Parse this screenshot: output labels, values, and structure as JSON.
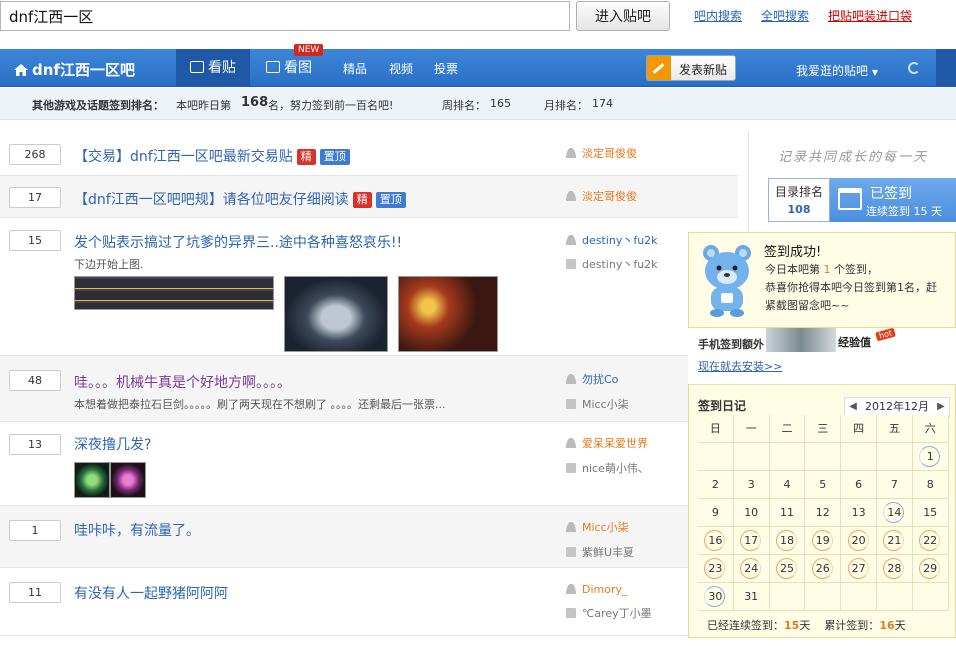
{
  "topbar": {
    "search_value": "dnf江西一区",
    "enter_label": "进入贴吧",
    "links": [
      "吧内搜索",
      "全吧搜索",
      "把贴吧装进口袋"
    ]
  },
  "nav": {
    "forum_title": "dnf江西一区吧",
    "tabs": [
      "看贴",
      "看图"
    ],
    "new_badge": "NEW",
    "links": [
      "精品",
      "视频",
      "投票"
    ],
    "post_button": "发表新贴",
    "fav_bars": "我爱逛的贴吧",
    "accent": "#2a6fc7"
  },
  "rank": {
    "label": "其他游戏及话题签到排名：",
    "yesterday_prefix": "本吧昨日第",
    "yesterday_rank": "168",
    "yesterday_suffix": "名，努力签到前一百名吧!",
    "week_label": "周排名：",
    "week_rank": "165",
    "month_label": "月排名：",
    "month_rank": "174"
  },
  "threads": [
    {
      "count": "268",
      "title": "【交易】dnf江西一区吧最新交易贴",
      "tags": [
        "精",
        "置顶"
      ],
      "author": "淡定哥俊俊"
    },
    {
      "count": "17",
      "title": "【dnf江西一区吧吧规】请各位吧友仔细阅读",
      "tags": [
        "精",
        "置顶"
      ],
      "author": "淡定哥俊俊"
    },
    {
      "count": "15",
      "title": "发个贴表示搞过了坑爹的异界三..途中各种喜怒哀乐!!",
      "excerpt": "下边开始上图.",
      "author": "destiny丶fu2k",
      "last_reply": "destiny丶fu2k"
    },
    {
      "count": "48",
      "title": "哇。。。机械牛真是个好地方啊。。。。",
      "excerpt": "本想着做把泰拉石巨剑。。。。。刷了两天现在不想刷了 。。。。还剩最后一张票...",
      "author": "勿扰Co",
      "last_reply": "Micc小柒"
    },
    {
      "count": "13",
      "title": "深夜撸几发?",
      "author": "爱呆呆爱世界",
      "last_reply": "nice萌小伟、"
    },
    {
      "count": "1",
      "title": "哇咔咔，有流量了。",
      "author": "Micc小柒",
      "last_reply": "紫鲜U丰夏"
    },
    {
      "count": "11",
      "title": "有没有人一起野猪阿阿阿",
      "author": "Dimory_",
      "last_reply": "℃arey丁小墨"
    }
  ],
  "sidebar": {
    "slogan": "记录共同成长的每一天",
    "rank_label": "目录排名",
    "rank_value": "108",
    "signed_label": "已签到",
    "signed_days": "连续签到 15 天"
  },
  "popup": {
    "title": "签到成功!",
    "line1_prefix": "今日本吧第",
    "line1_num": "1",
    "line1_suffix": "个签到，",
    "line2": "恭喜你抢得本吧今日签到第1名，赶",
    "line3": "紧截图留念吧~~"
  },
  "mobile": {
    "heading": "手机签到额外",
    "exp": "经验值",
    "hot": "hot",
    "install_link": "现在就去安装>>"
  },
  "calendar": {
    "heading": "签到日记",
    "month": "2012年12月",
    "weekdays": [
      "日",
      "一",
      "二",
      "三",
      "四",
      "五",
      "六"
    ],
    "lead_blank": 6,
    "days": 31,
    "signed": [
      16,
      17,
      18,
      19,
      20,
      21,
      22,
      23,
      24,
      25,
      26,
      27,
      28,
      29,
      30
    ],
    "today_marks": [
      1,
      14,
      30
    ],
    "footer_prefix": "已经连续签到：",
    "continuous": "15",
    "footer_mid": "天",
    "total_prefix": "累计签到：",
    "total": "16",
    "footer_end": "天"
  }
}
